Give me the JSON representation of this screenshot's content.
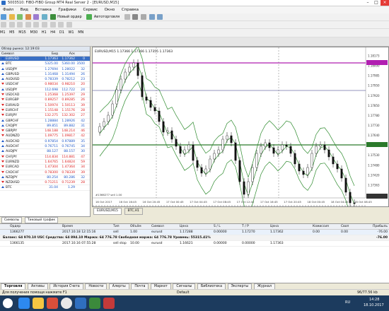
{
  "window": {
    "title": "5003510: FIBO-FIBO Group MT4 Real Server 2 - [EURUSD,M15]"
  },
  "menu": [
    "Файл",
    "Вид",
    "Вставка",
    "Графики",
    "Сервис",
    "Окно",
    "Справка"
  ],
  "toolbar": {
    "new_order": "Новый ордер",
    "autotrading": "Автоторговля"
  },
  "timeframes": [
    "M1",
    "M5",
    "M15",
    "M30",
    "H1",
    "H4",
    "D1",
    "W1",
    "MN"
  ],
  "market_watch": {
    "header": "Обзор рынка: 12:19:03",
    "columns": [
      "Символ",
      "Бид",
      "Аск",
      ""
    ],
    "rows": [
      {
        "s": "EURUSD",
        "b": "1.17363",
        "a": "1.17362",
        "sp": "0",
        "d": "up"
      },
      {
        "s": "BTC",
        "b": "5325.00",
        "a": "5360.00",
        "sp": "3500",
        "d": "up"
      },
      {
        "s": "USDJPY",
        "b": "1.27694",
        "a": "1.28022",
        "sp": "32",
        "d": "up"
      },
      {
        "s": "GBPUSD",
        "b": "1.31468",
        "a": "1.31494",
        "sp": "26",
        "d": "up"
      },
      {
        "s": "AUDUSD",
        "b": "0.78339",
        "a": "0.78212",
        "sp": "23",
        "d": "up"
      },
      {
        "s": "USDCHF",
        "b": "0.98034",
        "a": "0.98210",
        "sp": "20",
        "d": "dn"
      },
      {
        "s": "USDJPY",
        "b": "112.698",
        "a": "112.722",
        "sp": "24",
        "d": "up"
      },
      {
        "s": "USDCAD",
        "b": "1.25368",
        "a": "1.25397",
        "sp": "29",
        "d": "dn"
      },
      {
        "s": "EURGBP",
        "b": "0.89257",
        "a": "0.89285",
        "sp": "26",
        "d": "dn"
      },
      {
        "s": "EURAUD",
        "b": "1.50974",
        "a": "1.50113",
        "sp": "39",
        "d": "dn"
      },
      {
        "s": "EURCHF",
        "b": "1.15148",
        "a": "1.15176",
        "sp": "28",
        "d": "dn"
      },
      {
        "s": "EURJPY",
        "b": "132.275",
        "a": "132.302",
        "sp": "27",
        "d": "dn"
      },
      {
        "s": "GBPCHF",
        "b": "1.28884",
        "a": "1.28926",
        "sp": "42",
        "d": "up"
      },
      {
        "s": "CADJPY",
        "b": "89.851",
        "a": "89.882",
        "sp": "31",
        "d": "up"
      },
      {
        "s": "GBPJPY",
        "b": "148.188",
        "a": "148.214",
        "sp": "46",
        "d": "dn"
      },
      {
        "s": "AUDNZD",
        "b": "1.09775",
        "a": "1.09817",
        "sp": "42",
        "d": "dn"
      },
      {
        "s": "AUDCAD",
        "b": "0.97854",
        "a": "0.97889",
        "sp": "35",
        "d": "up"
      },
      {
        "s": "AUDCHF",
        "b": "0.76711",
        "a": "0.76745",
        "sp": "34",
        "d": "up"
      },
      {
        "s": "AUDJPY",
        "b": "88.127",
        "a": "88.157",
        "sp": "30",
        "d": "up"
      },
      {
        "s": "CHFJPY",
        "b": "114.834",
        "a": "114.881",
        "sp": "47",
        "d": "dn"
      },
      {
        "s": "EURNZD",
        "b": "1.64765",
        "a": "1.64824",
        "sp": "59",
        "d": "dn"
      },
      {
        "s": "EURCAD",
        "b": "1.47304",
        "a": "1.47364",
        "sp": "34",
        "d": "dn"
      },
      {
        "s": "CADCHF",
        "b": "0.78300",
        "a": "0.78339",
        "sp": "39",
        "d": "dn"
      },
      {
        "s": "NZDJPY",
        "b": "80.254",
        "a": "80.286",
        "sp": "32",
        "d": "up"
      },
      {
        "s": "NZDUSD",
        "b": "0.71211",
        "a": "0.71239",
        "sp": "28",
        "d": "dn"
      },
      {
        "s": "BTC",
        "b": "31.04",
        "a": "1.29",
        "sp": "",
        "d": "up"
      }
    ],
    "tabs": [
      "Символы",
      "Тиковый график"
    ]
  },
  "chart": {
    "header": "EURUSD,M15  1.17366 1.17366 1.17355 1.17363",
    "prices": [
      "1.18173",
      "1.18000",
      "1.17985",
      "1.17950",
      "1.17920",
      "1.17850",
      "1.17780",
      "1.17730",
      "1.17640",
      "1.17580",
      "1.17530",
      "1.17480",
      "1.17420",
      "1.17363",
      "1.17310"
    ],
    "times": [
      "16 Oct 2017",
      "16 Oct 16:45",
      "16 Oct 20:45",
      "17 Oct 00:45",
      "17 Oct 04:45",
      "17 Oct 08:45",
      "17 Oct 12:45",
      "17 Oct 16:45",
      "17 Oct 20:45",
      "18 Oct 00:45",
      "18 Oct 04:45",
      "18 Oct 08:45"
    ],
    "order_label": "#1366277 sell 1.00",
    "tabs": [
      "EURUSD,M15",
      "BTC,H1"
    ]
  },
  "colors": {
    "resistance": "#b11fb1",
    "support": "#2b7a2b",
    "bid_line": "#5a5a5a",
    "bands": "#2e8b2e",
    "candle": "#111111"
  },
  "terminal": {
    "columns": [
      "Ордер",
      "Время",
      "Тип",
      "Объём",
      "Символ",
      "Цена",
      "S / L",
      "T / P",
      "Цена",
      "Комиссия",
      "Своп",
      "Прибыль"
    ],
    "rows": [
      {
        "o": "1366277",
        "t": "2017.10.18 12:15:16",
        "tp": "sell",
        "v": "1.00",
        "s": "eurusd",
        "p": "1.17288",
        "sl": "0.00000",
        "tpv": "1.17270",
        "cp": "1.17362",
        "c": "0.00",
        "sw": "0.00",
        "pr": "-76.00"
      },
      {
        "bal": "Баланс: 64 970.10 USC  Средства: 64 894.10  Маржа: 64 776.78  Свободная маржа: 64 776.78  Уровень: 55315.41%",
        "pr": "-76.00"
      },
      {
        "o": "1366135",
        "t": "2017.10.16 07:55:28",
        "tp": "sell stop",
        "v": "10.00",
        "s": "eurusd",
        "p": "1.16621",
        "sl": "0.00000",
        "tpv": "0.00000",
        "cp": "1.17363",
        "c": "",
        "sw": "",
        "pr": ""
      }
    ],
    "tabs": [
      "Торговля",
      "Активы",
      "История Счета",
      "Новости",
      "Алерты",
      "Почта",
      "Маркет",
      "Сигналы",
      "Библиотека",
      "Эксперты",
      "Журнал"
    ],
    "status": "Для получения помощи нажмите F1",
    "status_right": "Default",
    "net": "96/77.56 kb"
  },
  "taskbar": {
    "lang": "RU",
    "time": "14:28",
    "date": "18.10.2017"
  }
}
